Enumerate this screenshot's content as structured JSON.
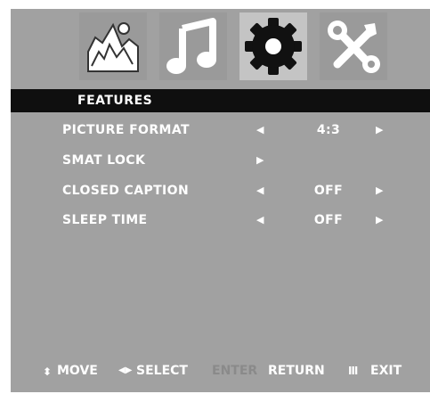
{
  "tabs": [
    {
      "icon": "picture-icon",
      "active": false
    },
    {
      "icon": "music-note-icon",
      "active": false
    },
    {
      "icon": "gear-icon",
      "active": true
    },
    {
      "icon": "tools-icon",
      "active": false
    }
  ],
  "menu": {
    "title": "FEATURES",
    "rows": [
      {
        "label": "PICTURE FORMAT",
        "left_arrow": "◀",
        "value": "4:3",
        "right_arrow": "▶"
      },
      {
        "label": "SMAT LOCK",
        "left_arrow": "▶",
        "value": "",
        "right_arrow": ""
      },
      {
        "label": "CLOSED CAPTION",
        "left_arrow": "◀",
        "value": "OFF",
        "right_arrow": "▶"
      },
      {
        "label": "SLEEP TIME",
        "left_arrow": "◀",
        "value": "OFF",
        "right_arrow": "▶"
      }
    ]
  },
  "footer": {
    "move_icon": "⬍",
    "move_label": "MOVE",
    "select_icon": "◀▶",
    "select_label": "SELECT",
    "enter_label": "ENTER",
    "return_label": "RETURN",
    "exit_icon": "Ⅲ",
    "exit_label": "EXIT"
  },
  "colors": {
    "panel": "#a1a1a1",
    "header_bar": "#0f0f0f",
    "text": "#ffffff",
    "active_tab": "#c4c4c4"
  }
}
